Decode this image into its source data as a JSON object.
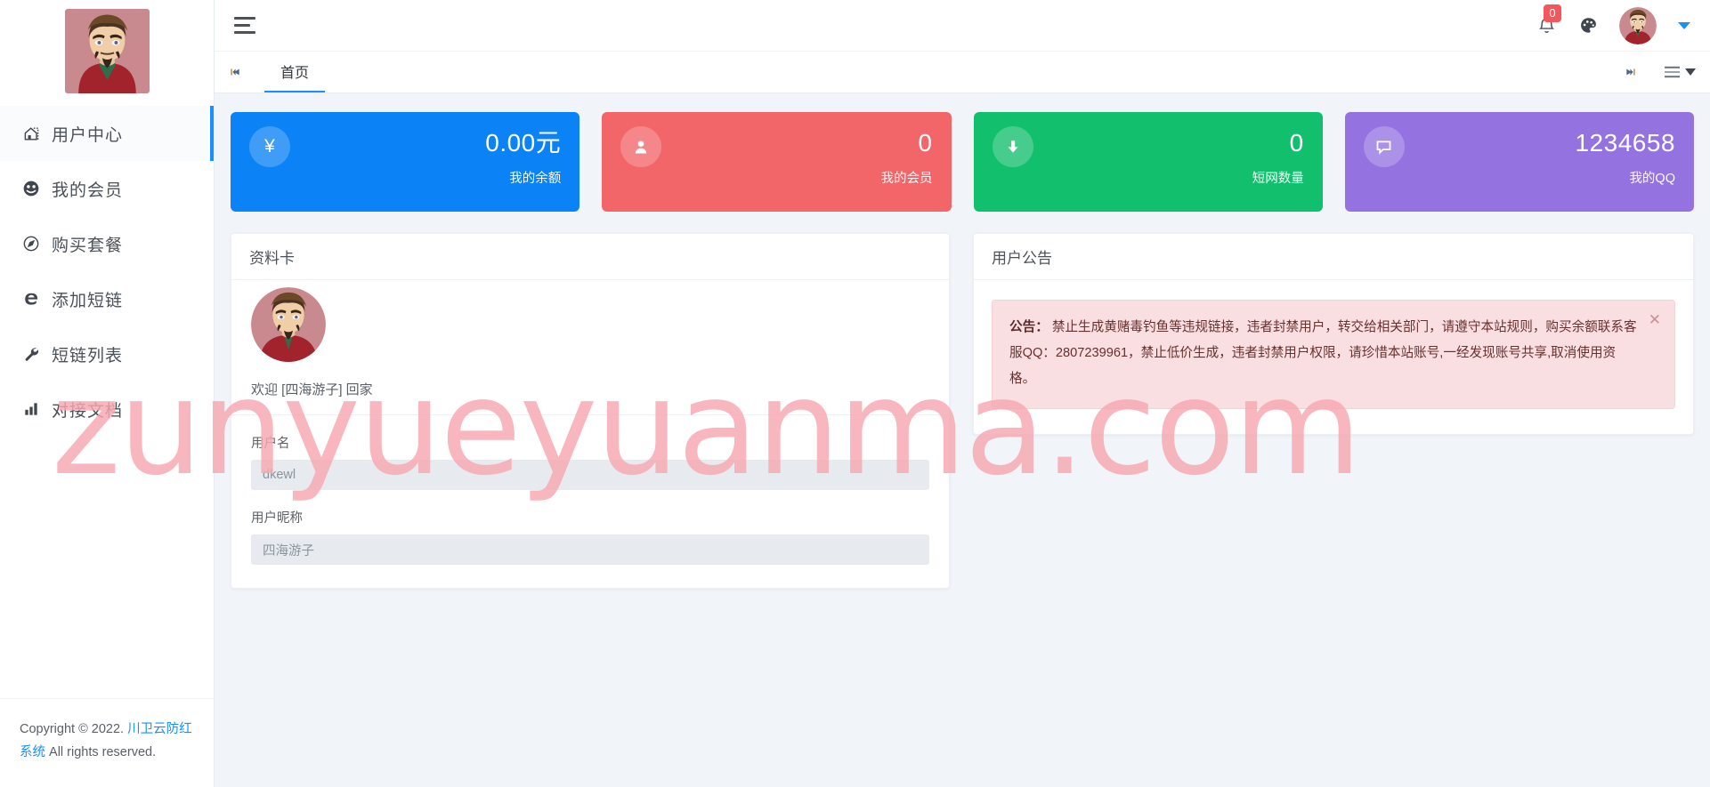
{
  "sidebar": {
    "logo_alt": "user-avatar-portrait",
    "items": [
      {
        "label": "用户中心",
        "icon": "home-icon",
        "active": true
      },
      {
        "label": "我的会员",
        "icon": "smiley-icon",
        "active": false
      },
      {
        "label": "购买套餐",
        "icon": "compass-icon",
        "active": false
      },
      {
        "label": "添加短链",
        "icon": "edge-e-icon",
        "active": false
      },
      {
        "label": "短链列表",
        "icon": "wrench-icon",
        "active": false
      },
      {
        "label": "对接文档",
        "icon": "bar-chart-icon",
        "active": false
      }
    ],
    "footer": {
      "prefix": "Copyright © 2022. ",
      "link": "川卫云防红系统",
      "suffix": " All rights reserved."
    }
  },
  "topbar": {
    "menu_toggle": "hamburger-icon",
    "notification_count": "0",
    "theme_icon": "palette-icon",
    "avatar_alt": "user-avatar",
    "dropdown_icon": "caret-down-icon"
  },
  "tabbar": {
    "prev_label": "⏮",
    "next_label": "⏭",
    "tabs": [
      {
        "label": "首页",
        "active": true
      }
    ],
    "menu_label": "≡"
  },
  "stat_cards": [
    {
      "icon": "¥",
      "icon_name": "yuan-icon",
      "value": "0.00元",
      "label": "我的余额",
      "color": "#0b82f5"
    },
    {
      "icon": "person",
      "icon_name": "person-icon",
      "value": "0",
      "label": "我的会员",
      "color": "#f2666a"
    },
    {
      "icon": "download",
      "icon_name": "download-arrow-icon",
      "value": "0",
      "label": "短网数量",
      "color": "#12bf6d"
    },
    {
      "icon": "comment",
      "icon_name": "comment-icon",
      "value": "1234658",
      "label": "我的QQ",
      "color": "#9472e0"
    }
  ],
  "profile_card": {
    "title": "资料卡",
    "avatar_alt": "profile-avatar",
    "welcome": "欢迎 [四海游子] 回家",
    "fields": [
      {
        "label": "用户名",
        "value": "dkewl"
      },
      {
        "label": "用户昵称",
        "value": "四海游子"
      }
    ]
  },
  "announcement_card": {
    "title": "用户公告",
    "alert_prefix": "公告：",
    "alert_text": " 禁止生成黄赌毒钓鱼等违规链接，违者封禁用户，转交给相关部门，请遵守本站规则，购买余额联系客服QQ：2807239961，禁止低价生成，违者封禁用户权限，请珍惜本站账号,一经发现账号共享,取消使用资格。",
    "close_label": "✕"
  },
  "watermark": {
    "text": "zunyueyuanma.com",
    "color": "#f7a8b0"
  }
}
